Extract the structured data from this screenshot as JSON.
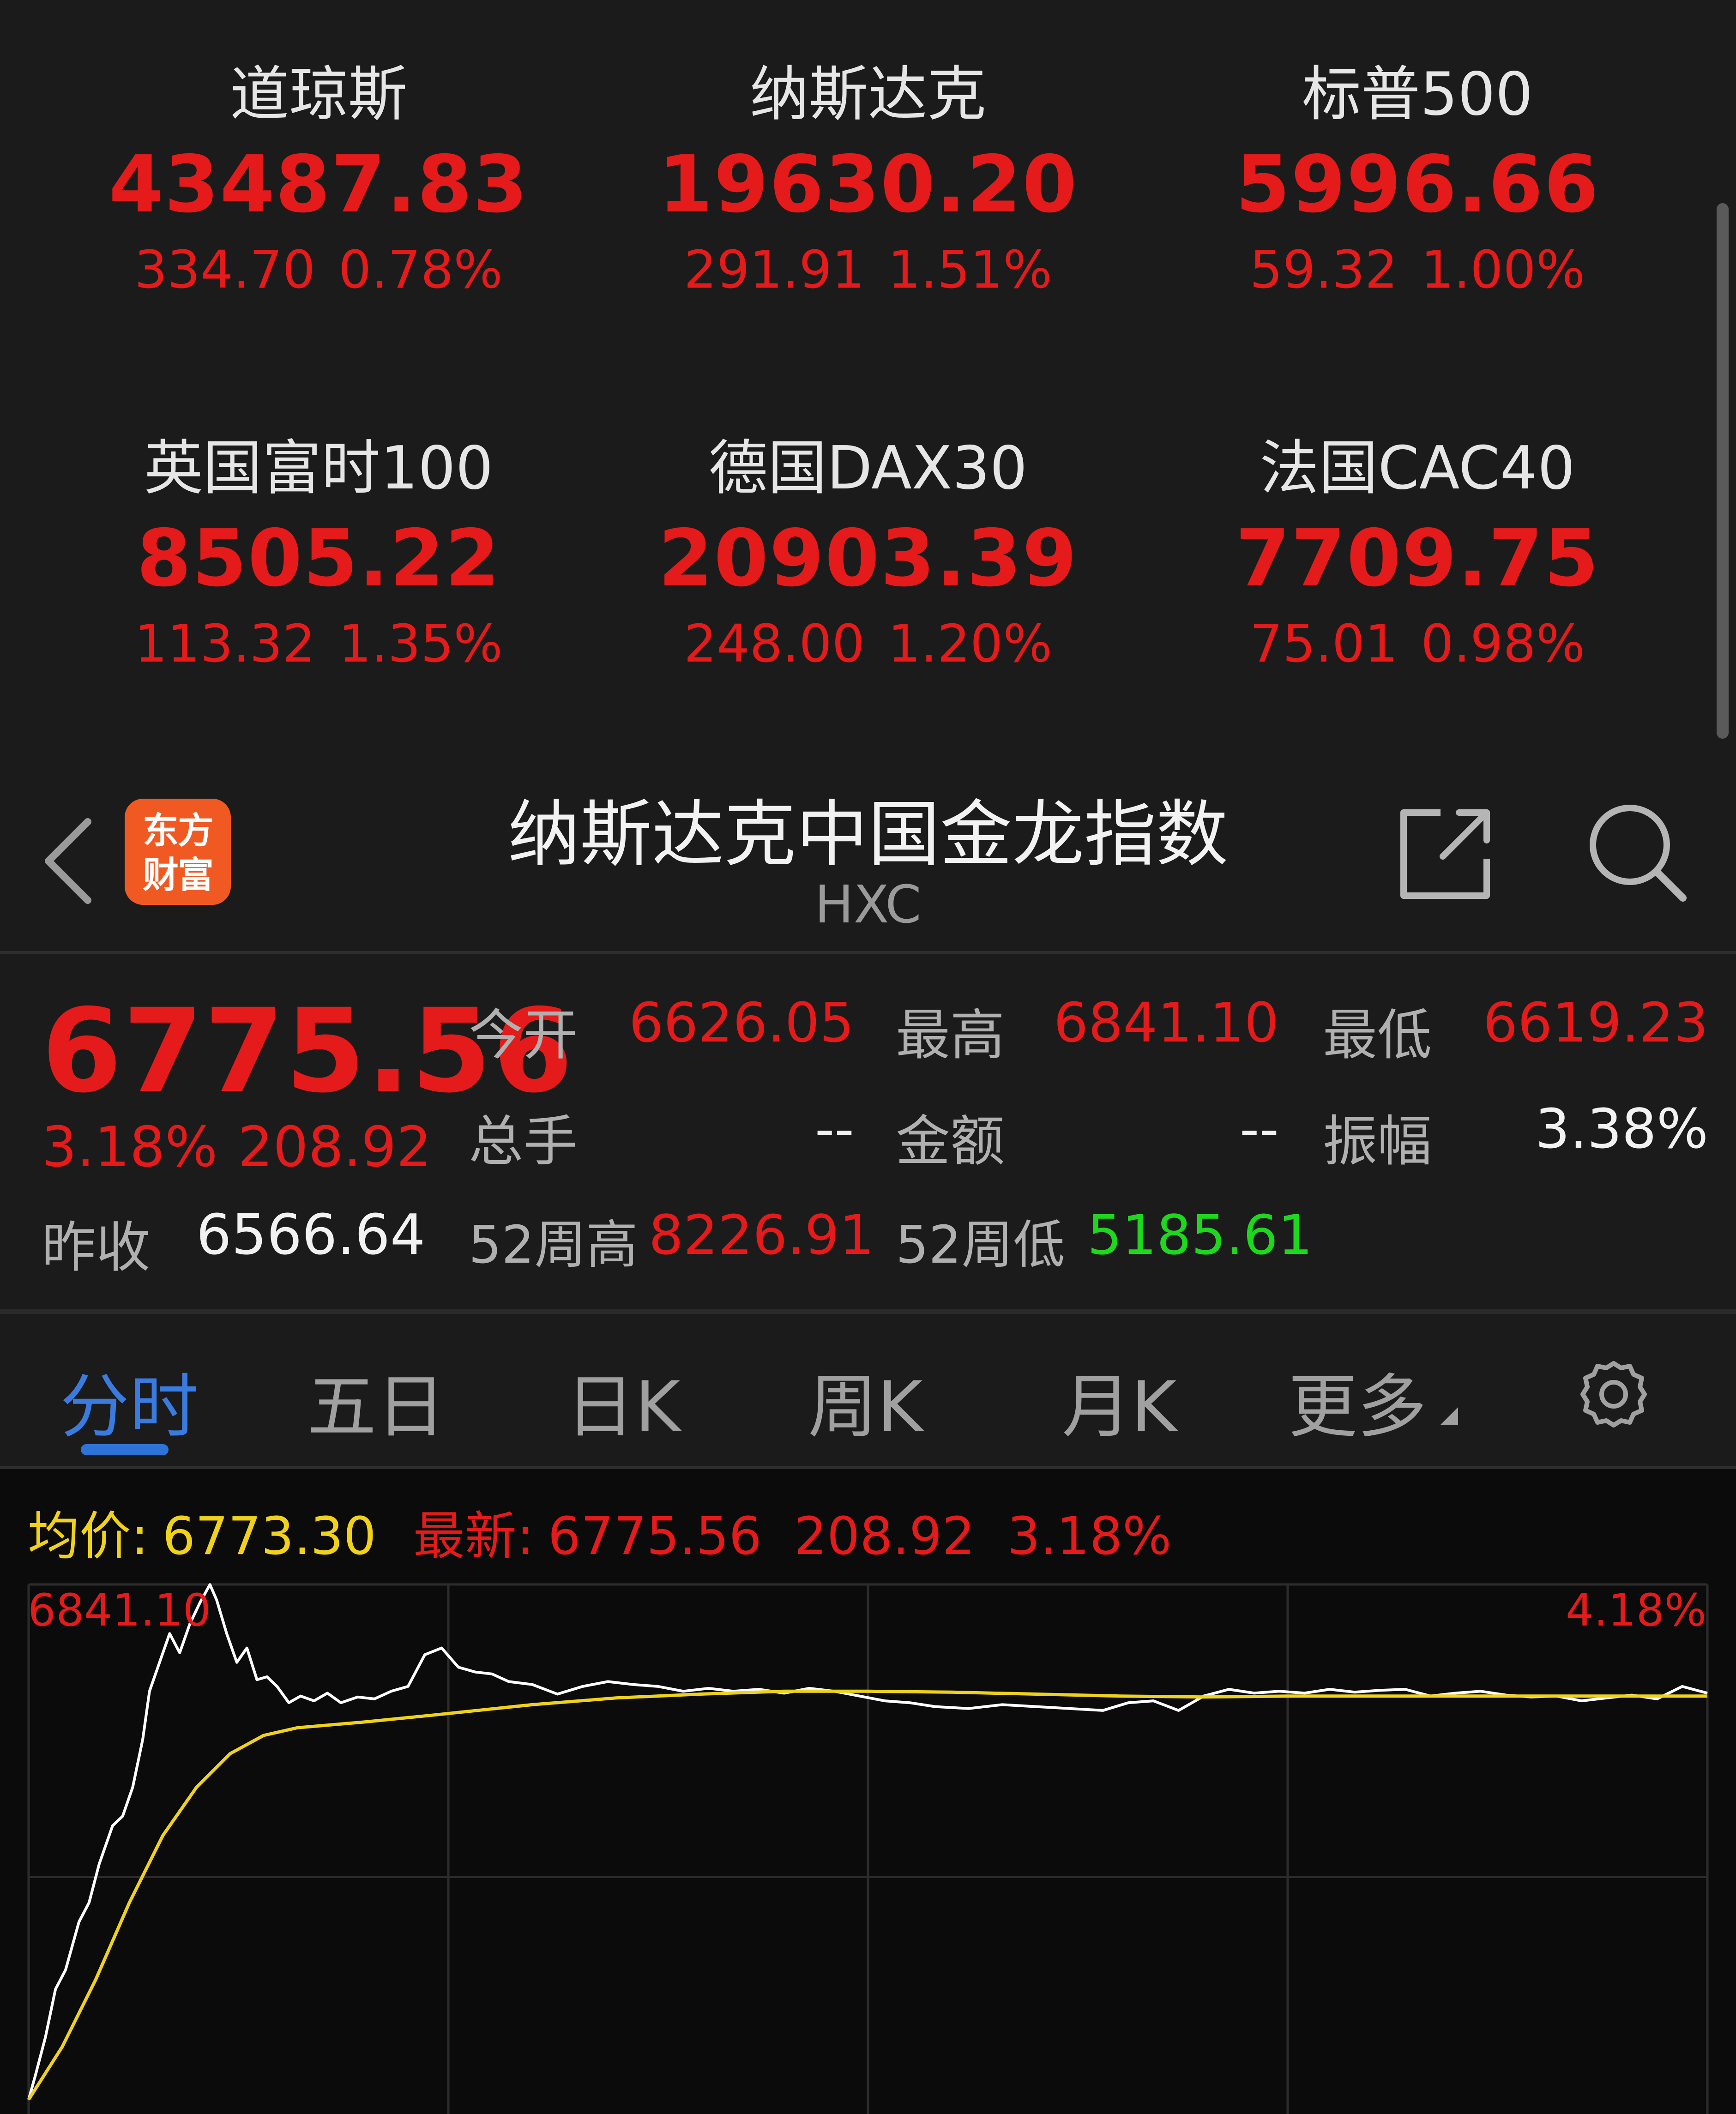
{
  "indices": [
    {
      "name": "道琼斯",
      "value": "43487.83",
      "change": "334.70",
      "pct": "0.78%"
    },
    {
      "name": "纳斯达克",
      "value": "19630.20",
      "change": "291.91",
      "pct": "1.51%"
    },
    {
      "name": "标普500",
      "value": "5996.66",
      "change": "59.32",
      "pct": "1.00%"
    },
    {
      "name": "英国富时100",
      "value": "8505.22",
      "change": "113.32",
      "pct": "1.35%"
    },
    {
      "name": "德国DAX30",
      "value": "20903.39",
      "change": "248.00",
      "pct": "1.20%"
    },
    {
      "name": "法国CAC40",
      "value": "7709.75",
      "change": "75.01",
      "pct": "0.98%"
    }
  ],
  "header": {
    "logo_line1": "东方",
    "logo_line2": "财富",
    "title": "纳斯达克中国金龙指数",
    "code": "HXC"
  },
  "quote": {
    "last_price": "6775.56",
    "pct_change": "3.18%",
    "abs_change": "208.92",
    "prev_close_label": "昨收",
    "prev_close": "6566.64",
    "open_label": "今开",
    "open": "6626.05",
    "high_label": "最高",
    "high": "6841.10",
    "low_label": "最低",
    "low": "6619.23",
    "volume_label": "总手",
    "volume": "--",
    "amount_label": "金额",
    "amount": "--",
    "amplitude_label": "振幅",
    "amplitude": "3.38%",
    "wk52_high_label": "52周高",
    "wk52_high": "8226.91",
    "wk52_low_label": "52周低",
    "wk52_low": "5185.61"
  },
  "tabs": [
    "分时",
    "五日",
    "日K",
    "周K",
    "月K",
    "更多"
  ],
  "active_tab": "分时",
  "chart_legend": {
    "avg_label": "均价:",
    "avg_value": "6773.30",
    "latest_label": "最新:",
    "latest_value": "6775.56",
    "latest_change": "208.92",
    "latest_pct": "3.18%"
  },
  "colors": {
    "up": "#e51a1a",
    "down": "#1ed81e",
    "accent": "#2e74d8",
    "avg_line": "#f0d21a",
    "price_line": "#ffffff",
    "logo_bg": "#f05a22"
  },
  "chart_data": {
    "type": "line",
    "axis_high_label": "6841.10",
    "axis_high_pct": "4.18%",
    "y_range": [
      6290.08,
      6841.1
    ],
    "x_range": [
      0,
      1
    ],
    "series": [
      {
        "values": [
          [
            0.0,
            6305
          ],
          [
            0.004,
            6330
          ],
          [
            0.01,
            6370
          ],
          [
            0.016,
            6420
          ],
          [
            0.022,
            6440
          ],
          [
            0.03,
            6490
          ],
          [
            0.036,
            6510
          ],
          [
            0.042,
            6550
          ],
          [
            0.05,
            6590
          ],
          [
            0.056,
            6600
          ],
          [
            0.062,
            6630
          ],
          [
            0.068,
            6680
          ],
          [
            0.072,
            6730
          ],
          [
            0.078,
            6760
          ],
          [
            0.084,
            6790
          ],
          [
            0.09,
            6770
          ],
          [
            0.096,
            6800
          ],
          [
            0.102,
            6822
          ],
          [
            0.108,
            6841
          ],
          [
            0.112,
            6825
          ],
          [
            0.118,
            6790
          ],
          [
            0.124,
            6760
          ],
          [
            0.13,
            6775
          ],
          [
            0.136,
            6742
          ],
          [
            0.142,
            6745
          ],
          [
            0.148,
            6735
          ],
          [
            0.155,
            6718
          ],
          [
            0.162,
            6725
          ],
          [
            0.17,
            6720
          ],
          [
            0.178,
            6728
          ],
          [
            0.186,
            6718
          ],
          [
            0.196,
            6724
          ],
          [
            0.206,
            6722
          ],
          [
            0.216,
            6730
          ],
          [
            0.226,
            6735
          ],
          [
            0.236,
            6768
          ],
          [
            0.246,
            6775
          ],
          [
            0.256,
            6755
          ],
          [
            0.266,
            6750
          ],
          [
            0.276,
            6748
          ],
          [
            0.286,
            6740
          ],
          [
            0.3,
            6737
          ],
          [
            0.315,
            6727
          ],
          [
            0.33,
            6735
          ],
          [
            0.345,
            6740
          ],
          [
            0.36,
            6737
          ],
          [
            0.375,
            6735
          ],
          [
            0.39,
            6730
          ],
          [
            0.405,
            6733
          ],
          [
            0.42,
            6730
          ],
          [
            0.435,
            6732
          ],
          [
            0.45,
            6728
          ],
          [
            0.465,
            6733
          ],
          [
            0.48,
            6730
          ],
          [
            0.495,
            6725
          ],
          [
            0.51,
            6720
          ],
          [
            0.525,
            6718
          ],
          [
            0.54,
            6714
          ],
          [
            0.56,
            6712
          ],
          [
            0.58,
            6716
          ],
          [
            0.6,
            6714
          ],
          [
            0.62,
            6712
          ],
          [
            0.64,
            6710
          ],
          [
            0.655,
            6718
          ],
          [
            0.67,
            6720
          ],
          [
            0.685,
            6710
          ],
          [
            0.7,
            6725
          ],
          [
            0.715,
            6732
          ],
          [
            0.73,
            6728
          ],
          [
            0.745,
            6730
          ],
          [
            0.76,
            6728
          ],
          [
            0.775,
            6732
          ],
          [
            0.79,
            6729
          ],
          [
            0.805,
            6731
          ],
          [
            0.82,
            6732
          ],
          [
            0.835,
            6725
          ],
          [
            0.85,
            6728
          ],
          [
            0.865,
            6730
          ],
          [
            0.88,
            6726
          ],
          [
            0.895,
            6724
          ],
          [
            0.91,
            6725
          ],
          [
            0.925,
            6720
          ],
          [
            0.94,
            6723
          ],
          [
            0.955,
            6726
          ],
          [
            0.97,
            6722
          ],
          [
            0.985,
            6735
          ],
          [
            1.0,
            6728
          ]
        ]
      },
      {
        "values": [
          [
            0.0,
            6305
          ],
          [
            0.02,
            6360
          ],
          [
            0.04,
            6430
          ],
          [
            0.06,
            6510
          ],
          [
            0.08,
            6580
          ],
          [
            0.1,
            6630
          ],
          [
            0.12,
            6665
          ],
          [
            0.14,
            6684
          ],
          [
            0.16,
            6692
          ],
          [
            0.2,
            6698
          ],
          [
            0.24,
            6705
          ],
          [
            0.3,
            6716
          ],
          [
            0.35,
            6723
          ],
          [
            0.4,
            6727
          ],
          [
            0.45,
            6730
          ],
          [
            0.5,
            6730
          ],
          [
            0.55,
            6729
          ],
          [
            0.6,
            6727
          ],
          [
            0.65,
            6725
          ],
          [
            0.7,
            6724
          ],
          [
            0.75,
            6725
          ],
          [
            0.8,
            6725
          ],
          [
            0.85,
            6725
          ],
          [
            0.9,
            6725
          ],
          [
            0.95,
            6725
          ],
          [
            1.0,
            6725
          ]
        ]
      }
    ]
  }
}
